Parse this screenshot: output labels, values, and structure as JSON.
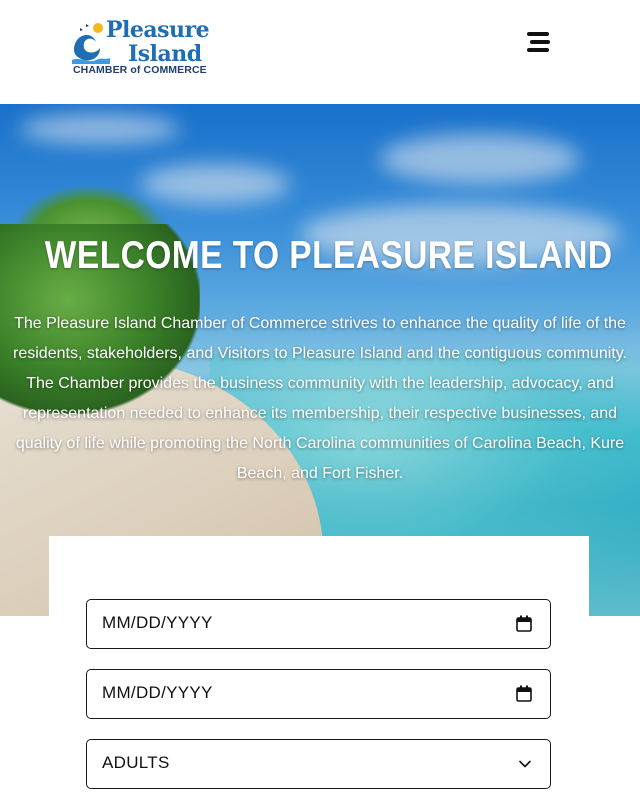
{
  "header": {
    "logo": {
      "title_line1": "Pleasure",
      "title_line2": "Island",
      "subtitle": "CHAMBER of COMMERCE"
    },
    "menu_icon": "hamburger-menu-icon",
    "colors": {
      "brand_blue": "#1f6db3",
      "accent_yellow": "#f6b71a"
    }
  },
  "hero": {
    "title": "WELCOME TO PLEASURE ISLAND",
    "description": "The Pleasure Island Chamber of Commerce strives to enhance the quality of life of the residents, stakeholders, and Visitors to Pleasure Island and the contiguous community. The Chamber provides the business community with the leadership, advocacy, and representation needed to enhance its membership, their respective businesses, and quality of life while promoting the North Carolina communities of Carolina Beach, Kure Beach, and Fort Fisher."
  },
  "booking": {
    "check_in": {
      "value": "MM/DD/YYYY",
      "icon": "calendar-icon"
    },
    "check_out": {
      "value": "MM/DD/YYYY",
      "icon": "calendar-icon"
    },
    "adults": {
      "selected": "ADULTS",
      "icon": "chevron-down-icon"
    }
  }
}
